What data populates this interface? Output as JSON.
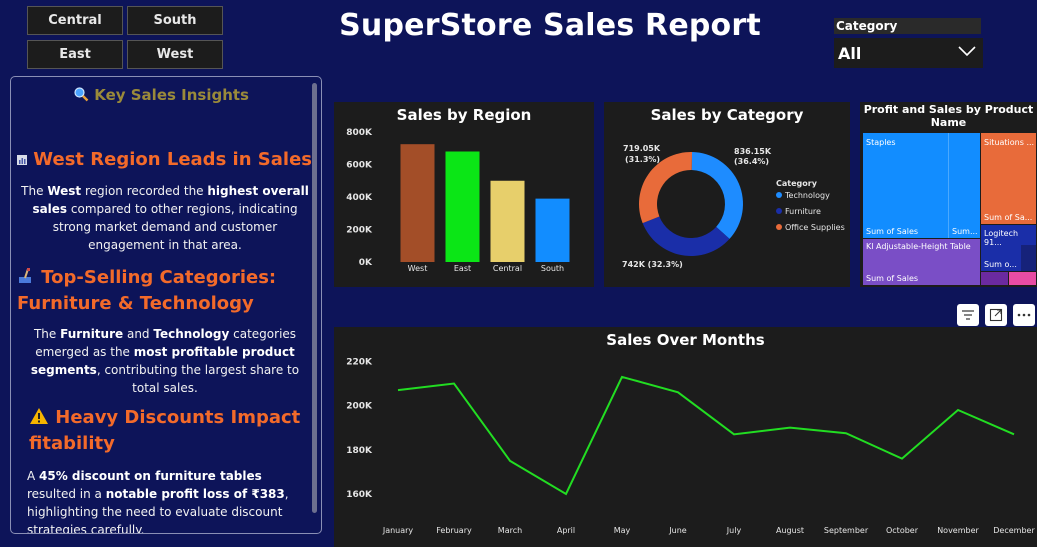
{
  "filters": {
    "regions": [
      "Central",
      "South",
      "East",
      "West"
    ]
  },
  "report": {
    "title": "SuperStore Sales Report"
  },
  "category_filter": {
    "label": "Category",
    "selected": "All"
  },
  "insights": {
    "title": "Key Sales Insights",
    "items": [
      {
        "heading": "West Region Leads in Sales",
        "body_parts": [
          "The ",
          "West",
          " region recorded the ",
          "highest overall sales",
          " compared to other regions, indicating strong market demand and customer engagement in that area."
        ]
      },
      {
        "heading_line1": "Top-Selling Categories:",
        "heading_line2": "Furniture & Technology",
        "body_parts": [
          "The ",
          "Furniture",
          " and ",
          "Technology",
          " categories emerged as the ",
          "most profitable product segments",
          ", contributing the largest share to total sales."
        ]
      },
      {
        "heading_line1": "Heavy Discounts Impact",
        "heading_line2": "fitability",
        "body_parts": [
          "A ",
          "45% discount on furniture tables",
          " resulted in a ",
          "notable profit loss of ₹383",
          ", highlighting the need to evaluate discount strategies carefully."
        ]
      }
    ]
  },
  "colors": {
    "background": "#0d1459",
    "panel": "#1c1c1c",
    "accent_orange": "#f36a2a",
    "line_green": "#22dd22"
  },
  "chart_data": [
    {
      "type": "bar",
      "title": "Sales by Region",
      "categories": [
        "West",
        "East",
        "Central",
        "South"
      ],
      "values": [
        725000,
        680000,
        500000,
        390000
      ],
      "colors": [
        "#a34e28",
        "#0be616",
        "#e7cf6b",
        "#128dff"
      ],
      "y_ticks": [
        "0K",
        "200K",
        "400K",
        "600K",
        "800K"
      ],
      "ylim": [
        0,
        800000
      ]
    },
    {
      "type": "pie",
      "title": "Sales by Category",
      "legend_title": "Category",
      "legend_position": "right",
      "slices": [
        {
          "name": "Technology",
          "value": 836150,
          "label": "836.15K",
          "pct": "(36.4%)",
          "color": "#1e8cff"
        },
        {
          "name": "Furniture",
          "value": 742000,
          "label": "742K (32.3%)",
          "pct": "",
          "color": "#1a2ea8"
        },
        {
          "name": "Office Supplies",
          "value": 719050,
          "label": "719.05K",
          "pct": "(31.3%)",
          "color": "#e86b3a"
        }
      ]
    },
    {
      "type": "treemap",
      "title": "Profit and Sales by Product Name",
      "tiles": [
        {
          "label": "Staples",
          "sub": "Sum of Sales",
          "sub2": "Sum...",
          "color": "#128dff"
        },
        {
          "label": "Situations ...",
          "sub": "Sum of Sa...",
          "color": "#e86b3a"
        },
        {
          "label": "Kl Adjustable-Height Table",
          "sub": "Sum of Sales",
          "color": "#7a4ec6"
        },
        {
          "label": "Logitech 91...",
          "sub": "Sum o...",
          "color": "#1a2ea8"
        }
      ]
    },
    {
      "type": "line",
      "title": "Sales Over Months",
      "categories": [
        "January",
        "February",
        "March",
        "April",
        "May",
        "June",
        "July",
        "August",
        "September",
        "October",
        "November",
        "December"
      ],
      "values": [
        207000,
        210000,
        175000,
        160000,
        213000,
        206000,
        187000,
        190000,
        187500,
        176000,
        198000,
        187000
      ],
      "y_ticks": [
        "160K",
        "180K",
        "200K",
        "220K"
      ],
      "ylim": [
        155000,
        222000
      ],
      "color": "#22dd22"
    }
  ]
}
